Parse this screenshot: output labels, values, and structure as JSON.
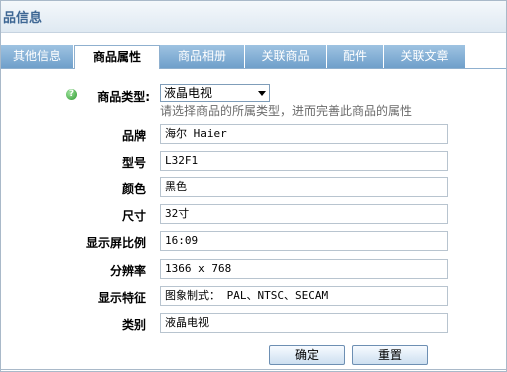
{
  "title": "品信息",
  "tabs": [
    {
      "label": "其他信息"
    },
    {
      "label": "商品属性"
    },
    {
      "label": "商品相册"
    },
    {
      "label": "关联商品"
    },
    {
      "label": "配件"
    },
    {
      "label": "关联文章"
    }
  ],
  "active_tab": "商品属性",
  "goods_type": {
    "label": "商品类型:",
    "selected": "液晶电视",
    "hint": "请选择商品的所属类型，进而完善此商品的属性"
  },
  "attributes": [
    {
      "label": "品牌",
      "value": "海尔 Haier"
    },
    {
      "label": "型号",
      "value": "L32F1"
    },
    {
      "label": "颜色",
      "value": "黑色"
    },
    {
      "label": "尺寸",
      "value": "32寸"
    },
    {
      "label": "显示屏比例",
      "value": "16:09"
    },
    {
      "label": "分辨率",
      "value": "1366 x 768"
    },
    {
      "label": "显示特征",
      "value": "图象制式： PAL、NTSC、SECAM"
    },
    {
      "label": "类别",
      "value": "液晶电视"
    }
  ],
  "buttons": {
    "confirm": "确定",
    "reset": "重置"
  }
}
